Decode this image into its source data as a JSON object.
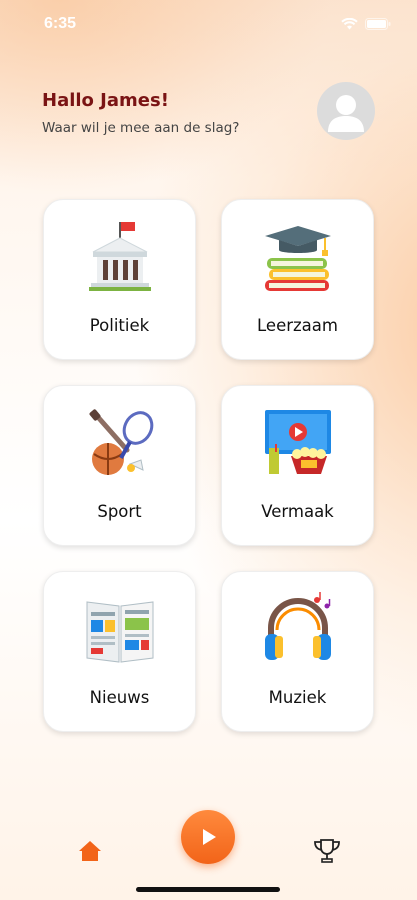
{
  "status_bar": {
    "time": "6:35"
  },
  "header": {
    "greeting": "Hallo James!",
    "subtitle": "Waar wil  je mee aan de slag?"
  },
  "categories": [
    {
      "label": "Politiek",
      "icon": "government-building-icon"
    },
    {
      "label": "Leerzaam",
      "icon": "books-graduation-cap-icon"
    },
    {
      "label": "Sport",
      "icon": "sports-equipment-icon"
    },
    {
      "label": "Vermaak",
      "icon": "entertainment-icon"
    },
    {
      "label": "Nieuws",
      "icon": "newspaper-icon"
    },
    {
      "label": "Muziek",
      "icon": "headphones-icon"
    }
  ],
  "bottom_nav": {
    "items": [
      "home-icon",
      "play-icon",
      "trophy-icon"
    ],
    "accent_color": "#f26419"
  },
  "colors": {
    "greeting": "#7a1414",
    "accent": "#f26419"
  }
}
